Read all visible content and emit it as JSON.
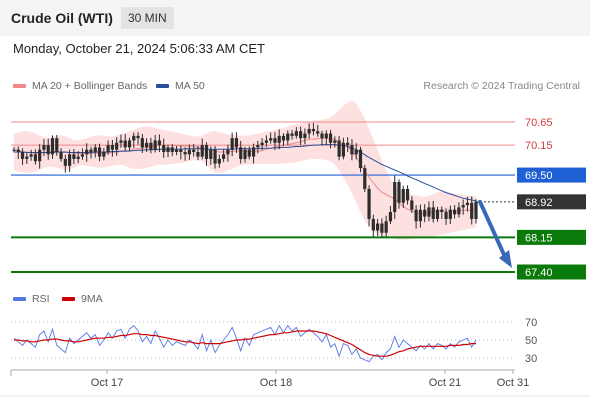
{
  "header": {
    "title": "Crude Oil (WTI)",
    "interval": "30 MIN",
    "datetime": "Monday, October 21, 2024 5:06:33 AM CET"
  },
  "legend": {
    "ma20_label": "MA 20 + Bollinger Bands",
    "ma50_label": "MA 50",
    "credit": "Research © 2024 Trading Central",
    "rsi_label": "RSI",
    "ma9_label": "9MA"
  },
  "colors": {
    "ma20": "#f08a8a",
    "ma50": "#2a4f9c",
    "bollinger_fill": "#fde0e0",
    "support_line": "#0a7a0a",
    "pivot_line": "#1f5fd4",
    "last_price": "#333333",
    "resistance_line": "#f08a8a",
    "arrow": "#3a68b8",
    "rsi_line": "#5577e6",
    "rsi_ma": "#d00000",
    "candle_body": "#2d2d2d",
    "candle_up": "#3aa53a",
    "candle_down": "#d62c2c"
  },
  "chart_data": [
    {
      "type": "candlestick",
      "title": "Crude Oil (WTI)",
      "timeframe": "30 MIN",
      "x_labels": [
        "Oct 17",
        "Oct 18",
        "Oct 21",
        "Oct 31"
      ],
      "ylim": [
        67.25,
        70.85
      ],
      "levels": [
        {
          "label": "70.65",
          "value": 70.65,
          "kind": "resistance"
        },
        {
          "label": "70.15",
          "value": 70.15,
          "kind": "resistance"
        },
        {
          "label": "69.50",
          "value": 69.5,
          "kind": "pivot"
        },
        {
          "label": "68.92",
          "value": 68.92,
          "kind": "last"
        },
        {
          "label": "68.15",
          "value": 68.15,
          "kind": "support"
        },
        {
          "label": "67.40",
          "value": 67.4,
          "kind": "support"
        }
      ],
      "closes": [
        70.05,
        70.0,
        69.85,
        69.9,
        69.95,
        69.8,
        70.05,
        70.15,
        69.95,
        70.3,
        70.0,
        69.85,
        69.7,
        69.95,
        69.85,
        69.9,
        69.95,
        70.05,
        70.0,
        70.1,
        69.9,
        70.0,
        70.15,
        70.05,
        70.2,
        70.25,
        70.1,
        70.25,
        70.35,
        70.3,
        70.1,
        70.2,
        70.05,
        70.25,
        70.15,
        70.0,
        70.1,
        70.0,
        70.05,
        70.0,
        69.95,
        70.05,
        70.0,
        69.9,
        70.15,
        69.85,
        70.05,
        69.75,
        69.85,
        69.95,
        70.05,
        70.3,
        70.1,
        69.85,
        70.05,
        69.9,
        70.1,
        70.15,
        70.2,
        70.25,
        70.3,
        70.2,
        70.35,
        70.25,
        70.4,
        70.35,
        70.45,
        70.3,
        70.4,
        70.5,
        70.45,
        70.4,
        70.3,
        70.4,
        70.2,
        70.25,
        69.9,
        70.2,
        70.15,
        69.95,
        70.05,
        69.65,
        69.2,
        68.55,
        68.3,
        68.45,
        68.25,
        68.5,
        68.7,
        69.35,
        68.9,
        69.2,
        68.95,
        68.75,
        68.5,
        68.75,
        68.6,
        68.8,
        68.55,
        68.75,
        68.7,
        68.55,
        68.75,
        68.65,
        68.8,
        68.85,
        68.9,
        68.55,
        68.92
      ],
      "ma20": [
        70.05,
        70.04,
        70.0,
        70.0,
        69.99,
        69.97,
        69.97,
        69.99,
        69.99,
        70.01,
        70.01,
        70.0,
        69.99,
        69.99,
        69.98,
        69.97,
        69.97,
        69.97,
        69.97,
        69.98,
        69.97,
        69.96,
        69.98,
        69.99,
        70.0,
        70.01,
        70.02,
        70.03,
        70.07,
        70.07,
        70.08,
        70.1,
        70.11,
        70.13,
        70.15,
        70.14,
        70.15,
        70.14,
        70.14,
        70.13,
        70.13,
        70.13,
        70.12,
        70.1,
        70.08,
        70.05,
        70.05,
        70.02,
        70.0,
        70.0,
        70.0,
        70.02,
        70.02,
        70.02,
        70.02,
        70.01,
        70.01,
        70.02,
        70.03,
        70.06,
        70.08,
        70.1,
        70.12,
        70.14,
        70.16,
        70.18,
        70.2,
        70.22,
        70.25,
        70.28,
        70.28,
        70.29,
        70.3,
        70.3,
        70.28,
        70.27,
        70.21,
        70.18,
        70.12,
        70.02,
        69.9,
        69.74,
        69.6,
        69.45,
        69.33,
        69.22,
        69.13,
        69.08,
        69.03,
        68.98,
        68.9,
        68.82,
        68.76,
        68.72,
        68.68,
        68.66,
        68.66,
        68.68,
        68.7,
        68.72,
        68.73,
        68.72,
        68.71,
        68.72,
        68.73,
        68.74,
        68.74,
        68.74,
        68.76
      ],
      "ma50": [
        70.0,
        70.0,
        70.0,
        69.99,
        69.99,
        69.99,
        69.99,
        69.99,
        69.99,
        69.99,
        70.0,
        70.0,
        70.0,
        69.99,
        69.99,
        69.99,
        69.99,
        69.99,
        69.99,
        70.0,
        70.0,
        70.0,
        70.0,
        70.01,
        70.01,
        70.02,
        70.02,
        70.02,
        70.03,
        70.04,
        70.04,
        70.05,
        70.05,
        70.05,
        70.06,
        70.06,
        70.06,
        70.06,
        70.06,
        70.06,
        70.07,
        70.07,
        70.07,
        70.07,
        70.07,
        70.06,
        70.06,
        70.06,
        70.06,
        70.06,
        70.06,
        70.06,
        70.07,
        70.07,
        70.07,
        70.07,
        70.07,
        70.07,
        70.08,
        70.08,
        70.08,
        70.09,
        70.09,
        70.1,
        70.1,
        70.11,
        70.12,
        70.12,
        70.13,
        70.14,
        70.15,
        70.15,
        70.16,
        70.16,
        70.16,
        70.16,
        70.15,
        70.14,
        70.12,
        70.09,
        70.05,
        70.0,
        69.94,
        69.88,
        69.83,
        69.78,
        69.73,
        69.69,
        69.65,
        69.61,
        69.57,
        69.53,
        69.48,
        69.44,
        69.4,
        69.36,
        69.32,
        69.28,
        69.24,
        69.2,
        69.16,
        69.12,
        69.09,
        69.06,
        69.03,
        69.0,
        68.98,
        68.96,
        68.94
      ],
      "bollinger_upper": [
        70.4,
        70.42,
        70.45,
        70.46,
        70.44,
        70.4,
        70.35,
        70.32,
        70.3,
        70.32,
        70.35,
        70.36,
        70.34,
        70.3,
        70.26,
        70.25,
        70.28,
        70.3,
        70.33,
        70.35,
        70.36,
        70.36,
        70.34,
        70.33,
        70.35,
        70.38,
        70.42,
        70.45,
        70.48,
        70.52,
        70.55,
        70.56,
        70.55,
        70.52,
        70.5,
        70.48,
        70.46,
        70.44,
        70.42,
        70.4,
        70.38,
        70.36,
        70.34,
        70.33,
        70.36,
        70.4,
        70.45,
        70.46,
        70.43,
        70.4,
        70.38,
        70.37,
        70.36,
        70.35,
        70.35,
        70.36,
        70.38,
        70.4,
        70.42,
        70.44,
        70.46,
        70.48,
        70.5,
        70.52,
        70.55,
        70.58,
        70.6,
        70.62,
        70.64,
        70.66,
        70.68,
        70.69,
        70.7,
        70.72,
        70.75,
        70.82,
        70.92,
        71.0,
        71.08,
        71.12,
        71.05,
        70.9,
        70.72,
        70.5,
        70.28,
        70.05,
        69.82,
        69.6,
        69.42,
        69.28,
        69.2,
        69.14,
        69.1,
        69.08,
        69.06,
        69.04,
        69.03,
        69.05,
        69.09,
        69.13,
        69.15,
        69.14,
        69.12,
        69.1,
        69.08,
        69.06,
        69.05,
        69.04,
        69.04
      ],
      "bollinger_lower": [
        69.6,
        69.58,
        69.56,
        69.55,
        69.55,
        69.58,
        69.62,
        69.66,
        69.68,
        69.68,
        69.66,
        69.63,
        69.6,
        69.62,
        69.66,
        69.7,
        69.72,
        69.7,
        69.68,
        69.67,
        69.66,
        69.66,
        69.68,
        69.7,
        69.72,
        69.72,
        69.7,
        69.66,
        69.64,
        69.63,
        69.64,
        69.66,
        69.68,
        69.7,
        69.72,
        69.72,
        69.73,
        69.74,
        69.75,
        69.76,
        69.78,
        69.8,
        69.82,
        69.83,
        69.8,
        69.72,
        69.62,
        69.56,
        69.54,
        69.56,
        69.6,
        69.64,
        69.68,
        69.7,
        69.72,
        69.73,
        69.74,
        69.74,
        69.74,
        69.74,
        69.74,
        69.74,
        69.74,
        69.75,
        69.76,
        69.77,
        69.78,
        69.8,
        69.82,
        69.84,
        69.85,
        69.85,
        69.84,
        69.82,
        69.8,
        69.72,
        69.6,
        69.45,
        69.28,
        69.1,
        68.9,
        68.7,
        68.52,
        68.38,
        68.28,
        68.22,
        68.18,
        68.16,
        68.14,
        68.12,
        68.1,
        68.1,
        68.11,
        68.12,
        68.13,
        68.14,
        68.15,
        68.16,
        68.17,
        68.19,
        68.21,
        68.23,
        68.25,
        68.27,
        68.29,
        68.31,
        68.33,
        68.35,
        68.37
      ]
    },
    {
      "type": "line",
      "title": "RSI",
      "x_labels": [
        "Oct 17",
        "Oct 18",
        "Oct 21",
        "Oct 31"
      ],
      "yticks": [
        70,
        50,
        30
      ],
      "ylim": [
        20,
        80
      ],
      "series": [
        {
          "name": "RSI",
          "values": [
            52,
            48,
            44,
            50,
            46,
            42,
            56,
            60,
            48,
            62,
            44,
            40,
            36,
            52,
            46,
            50,
            54,
            58,
            52,
            56,
            44,
            50,
            58,
            52,
            60,
            62,
            52,
            62,
            66,
            60,
            48,
            54,
            46,
            60,
            52,
            42,
            50,
            44,
            48,
            46,
            44,
            50,
            46,
            40,
            56,
            38,
            50,
            36,
            44,
            50,
            56,
            64,
            52,
            38,
            52,
            44,
            56,
            58,
            60,
            62,
            64,
            56,
            66,
            58,
            66,
            60,
            64,
            54,
            58,
            62,
            58,
            54,
            48,
            56,
            42,
            46,
            32,
            46,
            44,
            34,
            40,
            30,
            28,
            26,
            32,
            34,
            28,
            36,
            40,
            54,
            42,
            50,
            46,
            42,
            38,
            44,
            40,
            46,
            40,
            46,
            44,
            40,
            46,
            42,
            48,
            50,
            52,
            42,
            50
          ]
        },
        {
          "name": "9MA",
          "values": [
            50,
            50,
            49,
            49,
            48,
            48,
            49,
            50,
            50,
            51,
            51,
            50,
            49,
            49,
            48,
            48,
            49,
            50,
            51,
            52,
            52,
            52,
            53,
            53,
            54,
            55,
            55,
            56,
            57,
            57,
            56,
            56,
            55,
            55,
            54,
            53,
            52,
            51,
            50,
            49,
            48,
            48,
            47,
            46,
            47,
            46,
            46,
            46,
            46,
            47,
            48,
            49,
            50,
            50,
            51,
            51,
            52,
            53,
            54,
            55,
            56,
            56,
            57,
            58,
            58,
            59,
            60,
            60,
            60,
            60,
            60,
            59,
            58,
            57,
            55,
            53,
            51,
            49,
            47,
            45,
            42,
            39,
            36,
            34,
            33,
            32,
            32,
            32,
            33,
            35,
            37,
            38,
            40,
            41,
            42,
            43,
            43,
            43,
            43,
            43,
            43,
            43,
            44,
            44,
            44,
            45,
            45,
            46,
            46
          ]
        }
      ]
    }
  ]
}
